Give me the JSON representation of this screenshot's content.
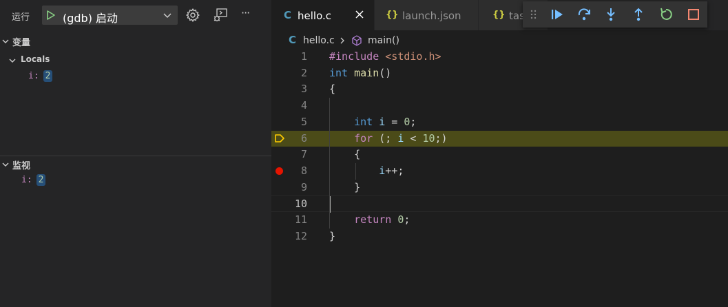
{
  "run_bar": {
    "label": "运行",
    "config": "(gdb) 启动",
    "start_icon": "play-icon",
    "chevron_icon": "chevron-down-icon",
    "gear_icon": "gear-icon",
    "terminal_icon": "debug-console-icon",
    "more_icon": "more-icon",
    "more_text": "···"
  },
  "variables": {
    "title": "变量",
    "scope": "Locals",
    "items": [
      {
        "name": "i:",
        "value": "2"
      }
    ]
  },
  "watch": {
    "title": "监视",
    "items": [
      {
        "name": "i:",
        "value": "2"
      }
    ]
  },
  "tabs": [
    {
      "icon": "C",
      "label": "hello.c"
    },
    {
      "icon": "{}",
      "label": "launch.json"
    },
    {
      "icon": "{}",
      "label": "tas"
    }
  ],
  "breadcrumb": {
    "file_icon": "C",
    "file": "hello.c",
    "symbol": "main()"
  },
  "debug_toolbar": [
    "drag-handle-icon",
    "continue-icon",
    "step-over-icon",
    "step-into-icon",
    "step-out-icon",
    "restart-icon",
    "stop-icon"
  ],
  "editor": {
    "current_line": 6,
    "breakpoint_line": 8,
    "cursor_line": 10,
    "lines": [
      {
        "n": "1",
        "text": "#include <stdio.h>"
      },
      {
        "n": "2",
        "text": "int main()"
      },
      {
        "n": "3",
        "text": "{"
      },
      {
        "n": "4",
        "text": ""
      },
      {
        "n": "5",
        "text": "    int i = 0;"
      },
      {
        "n": "6",
        "text": "    for (; i < 10;)"
      },
      {
        "n": "7",
        "text": "    {"
      },
      {
        "n": "8",
        "text": "        i++;"
      },
      {
        "n": "9",
        "text": "    }"
      },
      {
        "n": "10",
        "text": ""
      },
      {
        "n": "11",
        "text": "    return 0;"
      },
      {
        "n": "12",
        "text": "}"
      }
    ]
  },
  "colors": {
    "accent": "#519aba",
    "current_line_bg": "#4b4b18",
    "breakpoint": "#e51400",
    "debug_blue": "#75beff",
    "debug_green": "#89d185",
    "debug_red": "#f48771",
    "stack_frame": "#ffcc00"
  }
}
